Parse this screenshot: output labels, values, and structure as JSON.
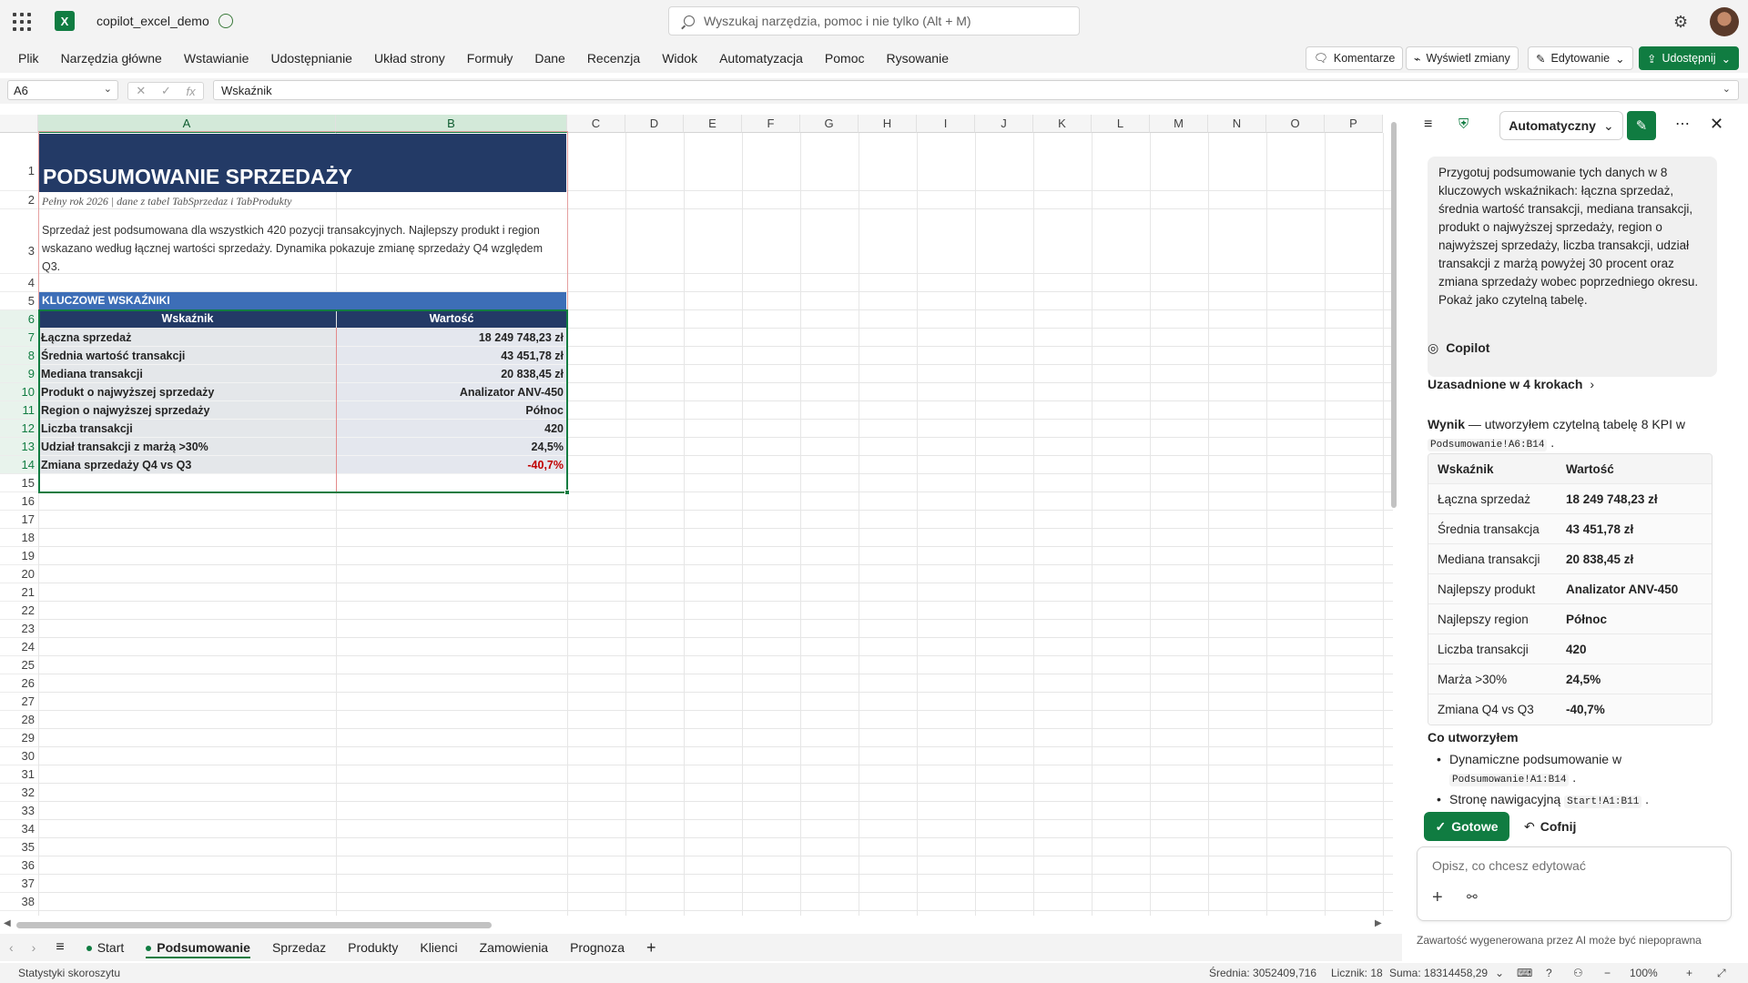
{
  "app": {
    "doc_name": "copilot_excel_demo",
    "search_placeholder": "Wyszukaj narzędzia, pomoc i nie tylko (Alt + M)",
    "brand_color": "#107c41"
  },
  "menu": [
    "Plik",
    "Narzędzia główne",
    "Wstawianie",
    "Udostępnianie",
    "Układ strony",
    "Formuły",
    "Dane",
    "Recenzja",
    "Widok",
    "Automatyzacja",
    "Pomoc",
    "Rysowanie"
  ],
  "ribbon_buttons": {
    "comments": "Komentarze",
    "show_changes": "Wyświetl zmiany",
    "editing": "Edytowanie",
    "share": "Udostępnij"
  },
  "formula": {
    "name_box": "A6",
    "value": "Wskaźnik"
  },
  "columns": [
    "A",
    "B",
    "C",
    "D",
    "E",
    "F",
    "G",
    "H",
    "I",
    "J",
    "K",
    "L",
    "M",
    "N",
    "O",
    "P"
  ],
  "rows": [
    "1",
    "2",
    "3",
    "4",
    "5",
    "6",
    "7",
    "8",
    "9",
    "10",
    "11",
    "12",
    "13",
    "14",
    "15",
    "16",
    "17",
    "18",
    "19",
    "20",
    "21",
    "22",
    "23",
    "24",
    "25",
    "26",
    "27",
    "28",
    "29",
    "30",
    "31",
    "32",
    "33",
    "34",
    "35",
    "36",
    "37",
    "38"
  ],
  "sheet": {
    "title": "PODSUMOWANIE SPRZEDAŻY",
    "subtitle": "Pełny rok 2026 | dane z tabel TabSprzedaz i TabProdukty",
    "description": "Sprzedaż jest podsumowana dla wszystkich 420 pozycji transakcyjnych. Najlepszy produkt i region wskazano według łącznej wartości sprzedaży. Dynamika pokazuje zmianę sprzedaży Q4 względem Q3.",
    "kpi_band": "KLUCZOWE WSKAŹNIKI",
    "header_a": "Wskaźnik",
    "header_b": "Wartość",
    "kpis": [
      {
        "label": "Łączna sprzedaż",
        "value": "18 249 748,23 zł"
      },
      {
        "label": "Średnia wartość transakcji",
        "value": "43 451,78 zł"
      },
      {
        "label": "Mediana transakcji",
        "value": "20 838,45 zł"
      },
      {
        "label": "Produkt o najwyższej sprzedaży",
        "value": "Analizator ANV-450"
      },
      {
        "label": "Region o najwyższej sprzedaży",
        "value": "Północ"
      },
      {
        "label": "Liczba transakcji",
        "value": "420"
      },
      {
        "label": "Udział transakcji z marżą >30%",
        "value": "24,5%"
      },
      {
        "label": "Zmiana sprzedaży Q4 vs Q3",
        "value": "-40,7%"
      }
    ]
  },
  "tabs": [
    {
      "label": "Start",
      "dot": true
    },
    {
      "label": "Podsumowanie",
      "dot": true,
      "active": true
    },
    {
      "label": "Sprzedaz"
    },
    {
      "label": "Produkty"
    },
    {
      "label": "Klienci"
    },
    {
      "label": "Zamowienia"
    },
    {
      "label": "Prognoza"
    }
  ],
  "status": {
    "left": "Statystyki skoroszytu",
    "avg": "Średnia: 3052409,716",
    "count": "Licznik: 18",
    "sum": "Suma: 18314458,29",
    "zoom": "100%"
  },
  "copilot": {
    "mode": "Automatyczny",
    "prompt": "Przygotuj podsumowanie tych danych w 8 kluczowych wskaźnikach: łączna sprzedaż, średnia wartość transakcji, mediana transakcji, produkt o najwyższej sprzedaży, region o najwyższej sprzedaży, liczba transakcji, udział transakcji z marżą powyżej 30 procent oraz zmiana sprzedaży wobec poprzedniego okresu. Pokaż jako czytelną tabelę.",
    "name": "Copilot",
    "grounded": "Uzasadnione w 4 krokach",
    "result_label": "Wynik",
    "result_text": " — utworzyłem czytelną tabelę 8 KPI w ",
    "result_ref": "Podsumowanie!A6:B14",
    "table_header": {
      "k": "Wskaźnik",
      "v": "Wartość"
    },
    "table": [
      {
        "k": "Łączna sprzedaż",
        "v": "18 249 748,23 zł"
      },
      {
        "k": "Średnia transakcja",
        "v": "43 451,78 zł"
      },
      {
        "k": "Mediana transakcji",
        "v": "20 838,45 zł"
      },
      {
        "k": "Najlepszy produkt",
        "v": "Analizator ANV-450"
      },
      {
        "k": "Najlepszy region",
        "v": "Północ"
      },
      {
        "k": "Liczba transakcji",
        "v": "420"
      },
      {
        "k": "Marża >30%",
        "v": "24,5%"
      },
      {
        "k": "Zmiana Q4 vs Q3",
        "v": "-40,7%"
      }
    ],
    "created_title": "Co utworzyłem",
    "created": [
      {
        "text": "Dynamiczne podsumowanie w ",
        "ref": "Podsumowanie!A1:B14"
      },
      {
        "text": "Stronę nawigacyjną ",
        "ref": "Start!A1:B11"
      }
    ],
    "done": "Gotowe",
    "undo": "Cofnij",
    "input_placeholder": "Opisz, co chcesz edytować",
    "disclaimer": "Zawartość wygenerowana przez AI może być niepoprawna"
  }
}
